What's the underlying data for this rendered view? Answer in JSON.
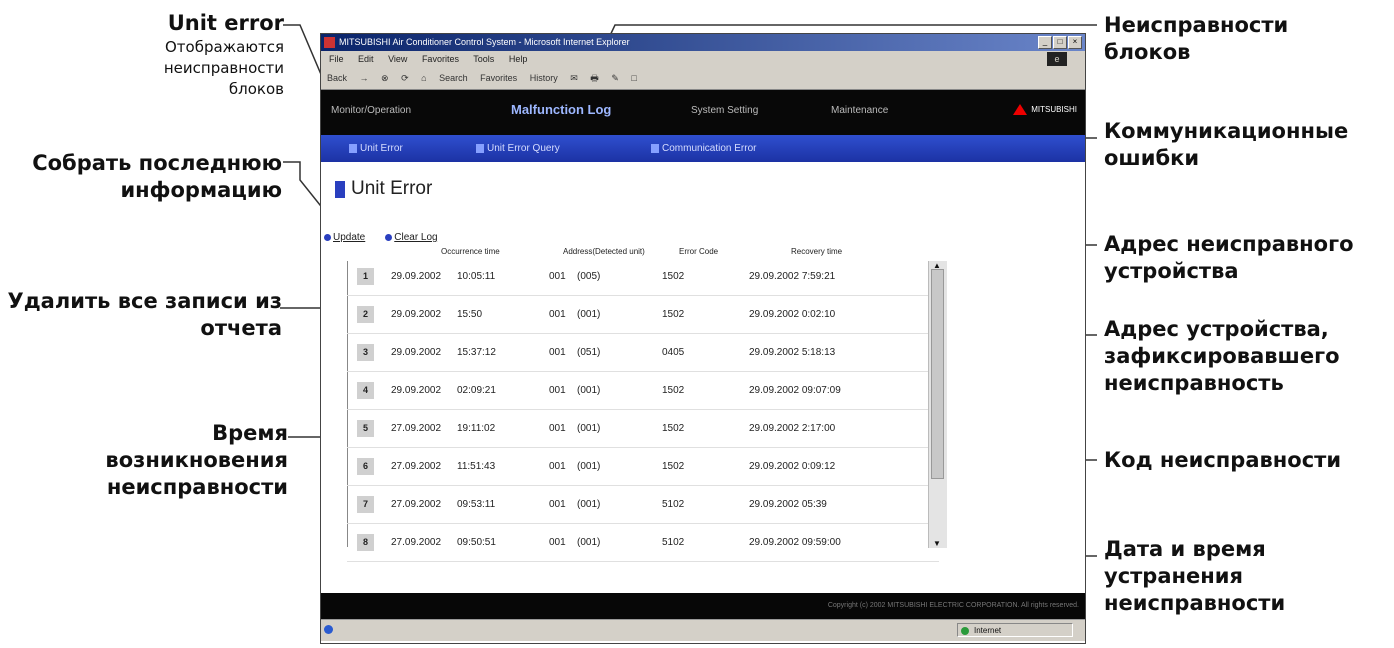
{
  "window": {
    "title": "MITSUBISHI Air Conditioner Control System - Microsoft Internet Explorer",
    "controls": [
      "_",
      "□",
      "×"
    ],
    "menu": [
      "File",
      "Edit",
      "View",
      "Favorites",
      "Tools",
      "Help"
    ],
    "toolbar": [
      "Back",
      "→",
      "⊗",
      "⟳",
      "⌂",
      "Search",
      "Favorites",
      "History",
      "✉",
      "🖶",
      "✎",
      "□"
    ],
    "brand": "MITSUBISHI"
  },
  "nav_primary": {
    "items": [
      "Monitor/Operation",
      "Malfunction Log",
      "System Setting",
      "Maintenance"
    ]
  },
  "nav_secondary": {
    "items": [
      "Unit Error",
      "Unit Error Query",
      "Communication Error"
    ]
  },
  "page": {
    "title": "Unit Error",
    "update_label": "Update",
    "clear_label": "Clear Log"
  },
  "table": {
    "headers": [
      "Occurrence time",
      "Address(Detected unit)",
      "Error Code",
      "Recovery time"
    ],
    "rows": [
      {
        "no": "1",
        "date": "29.09.2002",
        "time": "10:05:11",
        "address": "001",
        "detected": "(005)",
        "code": "1502",
        "recovery": "29.09.2002   7:59:21"
      },
      {
        "no": "2",
        "date": "29.09.2002",
        "time": "15:50",
        "address": "001",
        "detected": "(001)",
        "code": "1502",
        "recovery": "29.09.2002   0:02:10"
      },
      {
        "no": "3",
        "date": "29.09.2002",
        "time": "15:37:12",
        "address": "001",
        "detected": "(051)",
        "code": "0405",
        "recovery": "29.09.2002   5:18:13"
      },
      {
        "no": "4",
        "date": "29.09.2002",
        "time": "02:09:21",
        "address": "001",
        "detected": "(001)",
        "code": "1502",
        "recovery": "29.09.2002   09:07:09"
      },
      {
        "no": "5",
        "date": "27.09.2002",
        "time": "19:11:02",
        "address": "001",
        "detected": "(001)",
        "code": "1502",
        "recovery": "29.09.2002   2:17:00"
      },
      {
        "no": "6",
        "date": "27.09.2002",
        "time": "11:51:43",
        "address": "001",
        "detected": "(001)",
        "code": "1502",
        "recovery": "29.09.2002   0:09:12"
      },
      {
        "no": "7",
        "date": "27.09.2002",
        "time": "09:53:11",
        "address": "001",
        "detected": "(001)",
        "code": "5102",
        "recovery": "29.09.2002   05:39"
      },
      {
        "no": "8",
        "date": "27.09.2002",
        "time": "09:50:51",
        "address": "001",
        "detected": "(001)",
        "code": "5102",
        "recovery": "29.09.2002   09:59:00"
      }
    ]
  },
  "footer": "Copyright (c) 2002 MITSUBISHI ELECTRIC CORPORATION. All rights reserved.",
  "status": {
    "zone": "Internet"
  },
  "callouts": {
    "unit_error_title": "Unit error",
    "unit_error_sub": "Отображаются неисправности блоков",
    "collect": "Собрать последнюю информацию",
    "delete_all": "Удалить все записи из отчета",
    "time_occur": "Время возникновения неисправности",
    "unit_faults": "Неисправности блоков",
    "comm_errors": "Коммуникационные ошибки",
    "faulty_address": "Адрес неисправного устройства",
    "detected_address": "Адрес устройства, зафиксировавшего неисправность",
    "error_code": "Код неисправности",
    "recovery": "Дата и время устранения неисправности"
  },
  "colors": {
    "nav_blue": "#1c32a4",
    "nav_dark": "#080808",
    "accent": "#2a3fbf"
  }
}
